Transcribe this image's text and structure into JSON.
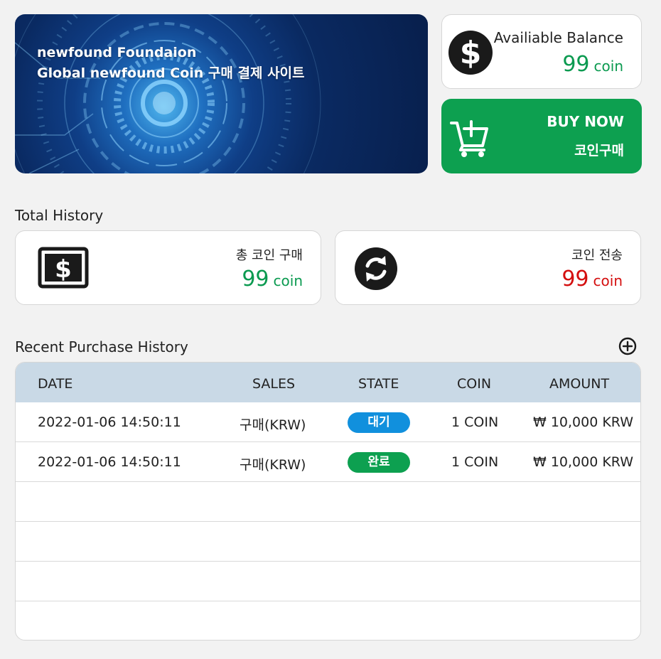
{
  "banner": {
    "line1": "newfound Foundaion",
    "line2": "Global newfound Coin 구매 결제 사이트"
  },
  "balance": {
    "label": "Availiable Balance",
    "value": "99",
    "unit": "coin"
  },
  "buy": {
    "label_en": "BUY NOW",
    "label_ko": "코인구매"
  },
  "total_history": {
    "title": "Total History",
    "purchase": {
      "label": "총 코인 구매",
      "value": "99",
      "unit": "coin"
    },
    "transfer": {
      "label": "코인 전송",
      "value": "99",
      "unit": "coin"
    }
  },
  "recent": {
    "title": "Recent Purchase History",
    "columns": [
      "DATE",
      "SALES",
      "STATE",
      "COIN",
      "AMOUNT"
    ],
    "rows": [
      {
        "date": "2022-01-06 14:50:11",
        "sales": "구매(KRW)",
        "state": "대기",
        "coin": "1 COIN",
        "amount": "₩ 10,000 KRW"
      },
      {
        "date": "2022-01-06 14:50:11",
        "sales": "구매(KRW)",
        "state": "완료",
        "coin": "1 COIN",
        "amount": "₩ 10,000 KRW"
      }
    ]
  },
  "colors": {
    "green": "#0da050",
    "red": "#d40f0f",
    "pending": "#1190dd",
    "header": "#c9d9e6"
  },
  "icons": [
    "dollar-circle-icon",
    "add-to-cart-icon",
    "dollar-bill-icon",
    "exchange-icon",
    "plus-circle-icon"
  ]
}
